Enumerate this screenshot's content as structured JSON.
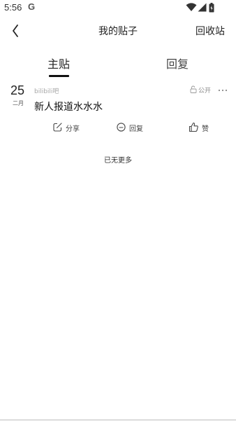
{
  "status_bar": {
    "time": "5:56",
    "google_glyph": "G",
    "icons": [
      "wifi-icon",
      "cellular-signal-icon",
      "battery-icon"
    ]
  },
  "nav": {
    "title": "我的贴子",
    "recycle_label": "回收站",
    "back_icon": "chevron-left-icon"
  },
  "tabs": [
    {
      "label": "主贴",
      "active": true
    },
    {
      "label": "回复",
      "active": false
    }
  ],
  "post": {
    "day": "25",
    "month": "二月",
    "forum": "bilibili吧",
    "visibility": "公开",
    "title": "新人报道水水水",
    "actions": {
      "share": "分享",
      "reply": "回复",
      "like": "赞"
    }
  },
  "end_text": "已无更多",
  "colors": {
    "background": "#ffffff",
    "text_primary": "#222222",
    "text_muted": "#a7a7a7",
    "tab_indicator": "#111111"
  }
}
